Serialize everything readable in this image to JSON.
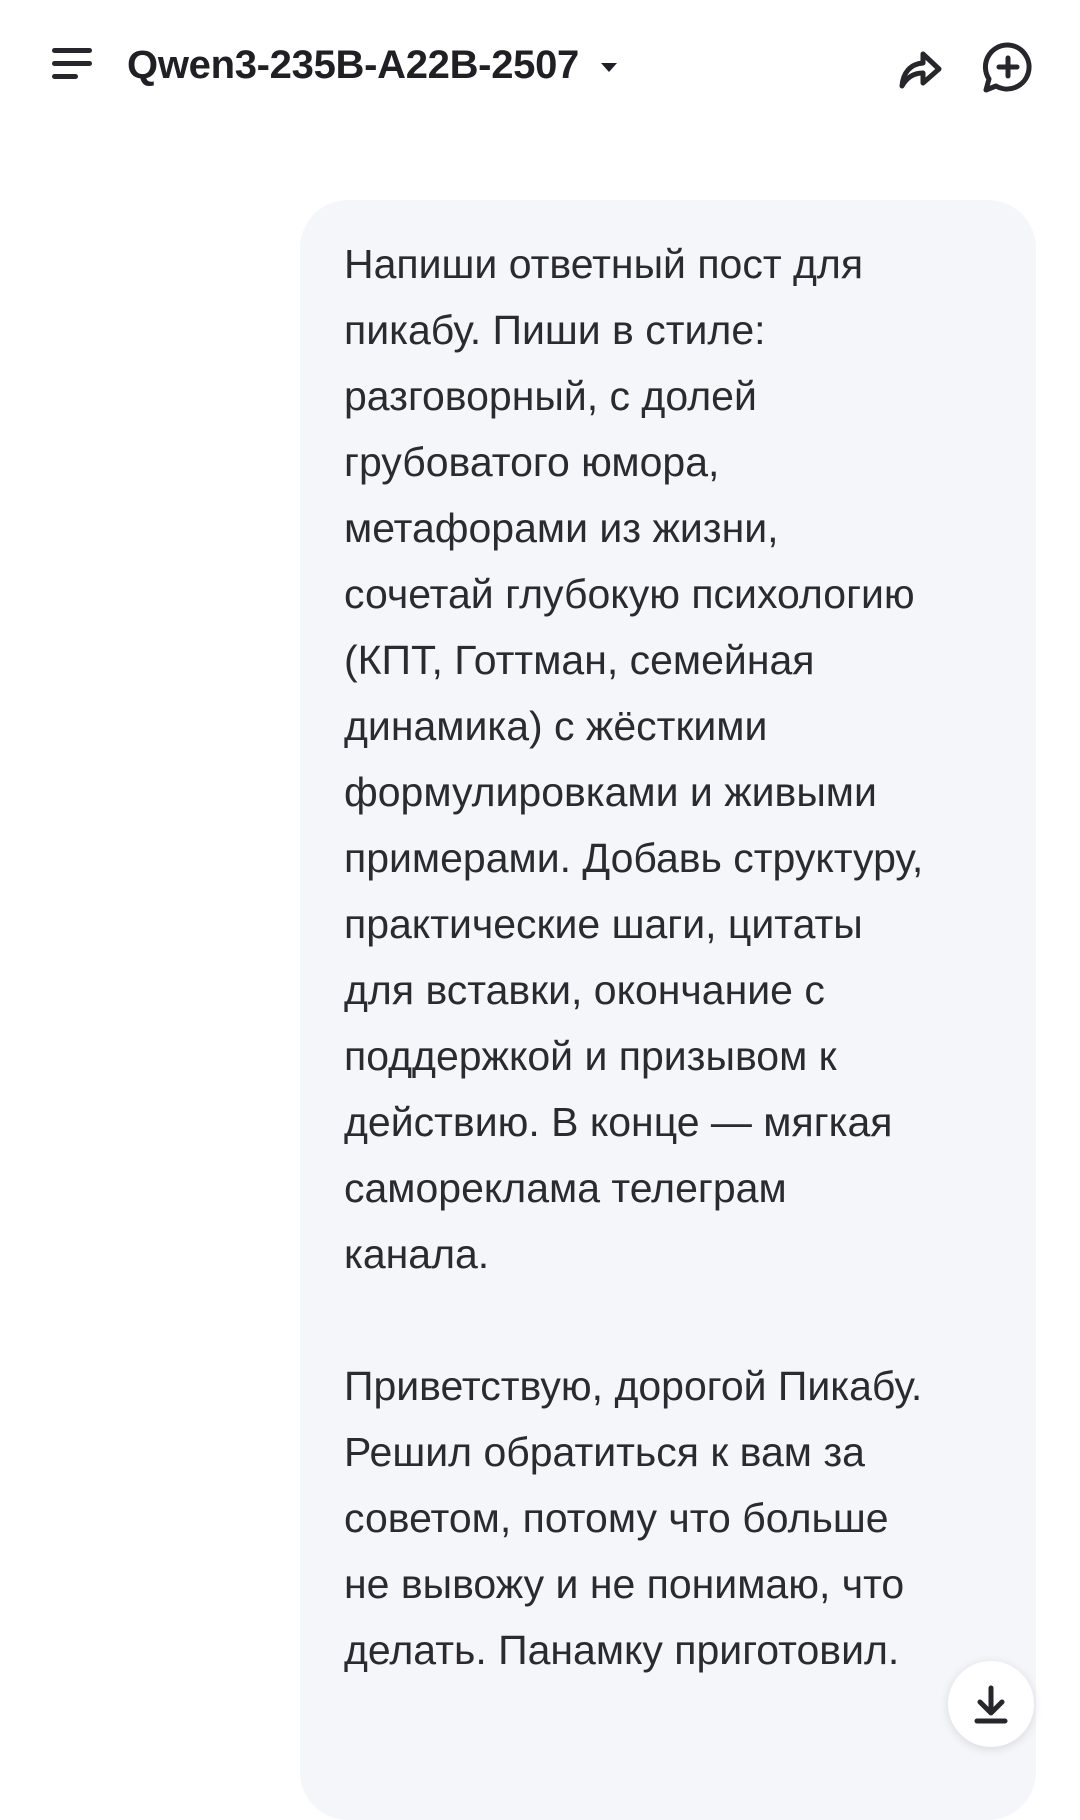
{
  "header": {
    "model_name": "Qwen3-235B-A22B-2507",
    "menu_icon": "hamburger-menu-icon",
    "caret_icon": "caret-down-icon",
    "share_icon": "share-icon",
    "new_chat_icon": "new-chat-icon"
  },
  "conversation": {
    "user_message": "Напиши ответный пост для\nпикабу. Пиши в стиле:\nразговорный, с долей\nгрубоватого юмора,\nметафорами из жизни,\nсочетай глубокую психологию\n(КПТ, Готтман, семейная\nдинамика) с жёсткими\nформулировками и живыми\nпримерами. Добавь структуру,\nпрактические шаги, цитаты\nдля вставки, окончание с\nподдержкой и призывом к\nдействию. В конце — мягкая\nсамореклама телеграм\nканала.\n\nПриветствую, дорогой Пикабу.\nРешил обратиться к вам за\nсоветом, потому что больше\nне вывожу и не понимаю, что\nделать. Панамку приготовил."
  },
  "controls": {
    "scroll_down_icon": "arrow-down-icon"
  },
  "colors": {
    "bubble_background": "#f5f6fa",
    "text": "#2a2a30",
    "icon": "#26262b"
  }
}
